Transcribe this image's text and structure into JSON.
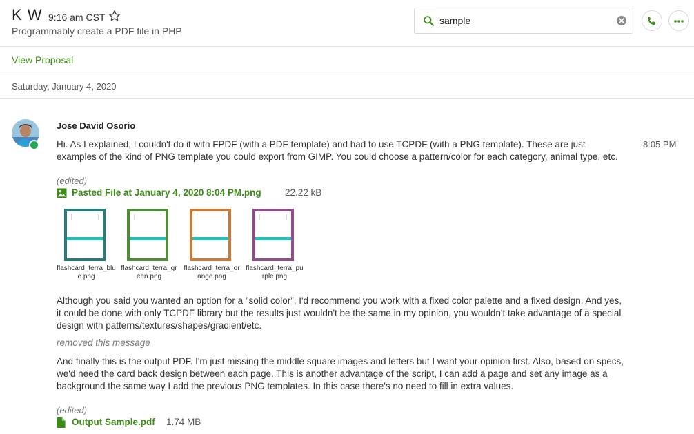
{
  "header": {
    "contact_name": "K W",
    "contact_time": "9:16 am CST",
    "subtitle": "Programmably create a PDF file in PHP",
    "search_value": "sample"
  },
  "proposal": {
    "label": "View Proposal"
  },
  "date_divider": "Saturday, January 4, 2020",
  "message": {
    "sender": "Jose David Osorio",
    "time": "8:05 PM",
    "paragraph1": "Hi. As I explained, I couldn't do it with FPDF (with a PDF template) and had to use TCPDF (with a PNG template). These are just examples of the kind of PNG template you could export from GIMP. You could choose a pattern/color for each category, animal type, etc.",
    "edited1": "(edited)",
    "file1": {
      "name": "Pasted File at January 4, 2020 8:04 PM.png",
      "size": "22.22 kB"
    },
    "thumbnails": [
      {
        "caption": "flashcard_terra_blue.png",
        "color": "#2a7a77"
      },
      {
        "caption": "flashcard_terra_green.png",
        "color": "#4f8a36"
      },
      {
        "caption": "flashcard_terra_orange.png",
        "color": "#c97a38"
      },
      {
        "caption": "flashcard_terra_purple.png",
        "color": "#8e4f86"
      }
    ],
    "band_color": "#2ebdb5",
    "paragraph2": "Although you said you wanted an option for a ”solid color”, I'd recommend you work with a fixed color palette and a fixed design. And yes, it could be done with only TCPDF library but the results just wouldn't be the same in my opinion, you wouldn't take advantage of a special design with patterns/textures/shapes/gradient/etc.",
    "removed": "removed this message",
    "paragraph3": "And finally this is the output PDF. I'm just missing the middle square images and letters but I want your opinion first. Also, based on specs, we'd need the card back design between each page. This is another advantage of the script, I can add a page and set any image as a background the same way I add the previous PNG templates. In this case there's no need to fill in extra values.",
    "edited2": "(edited)",
    "file2": {
      "name": "Output Sample.pdf",
      "size": "1.74 MB"
    }
  },
  "colors": {
    "accent": "#3d8c17",
    "online": "#21a556"
  }
}
